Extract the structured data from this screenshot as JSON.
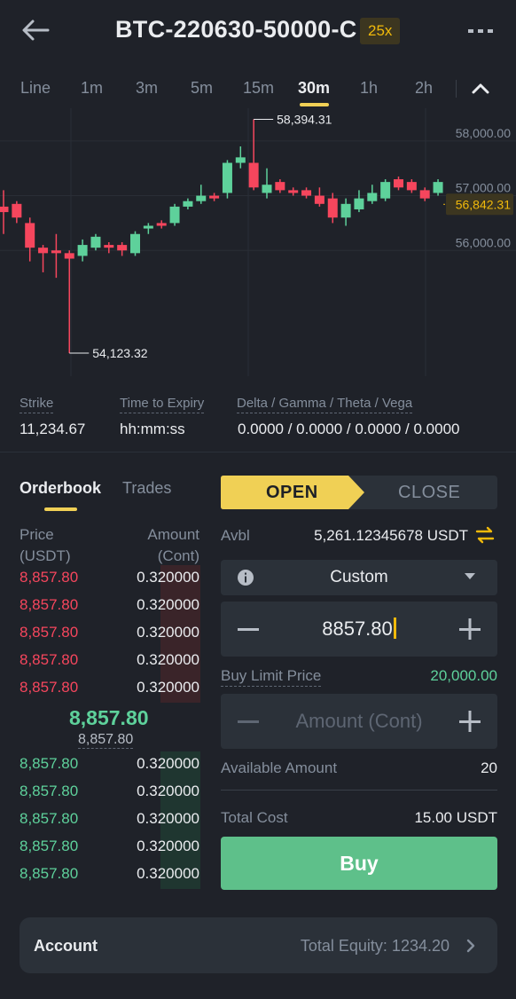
{
  "header": {
    "title": "BTC-220630-50000-C",
    "leverage": "25x",
    "icons": {
      "back": "back-arrow-icon",
      "more": "more-dots-icon"
    }
  },
  "intervals": {
    "items": [
      "Line",
      "1m",
      "3m",
      "5m",
      "15m",
      "30m",
      "1h",
      "2h"
    ],
    "active": "30m",
    "collapse_icon": "chevron-up-icon"
  },
  "chart": {
    "high_label": "58,394.31",
    "low_label": "54,123.32",
    "y_ticks": [
      "58,000.00",
      "57,000.00",
      "56,000.00"
    ],
    "last_price": "56,842.31",
    "colors": {
      "up": "#5ed19b",
      "down": "#f6465d",
      "last": "#f0b90b"
    }
  },
  "chart_data": {
    "type": "candlestick",
    "title": "",
    "ylim": [
      53800,
      58500
    ],
    "y_ticks": [
      58000,
      57000,
      56000
    ],
    "last_price": 56842.31,
    "high": 58394.31,
    "low": 54123.32,
    "candles": [
      {
        "o": 56800,
        "c": 56700,
        "h": 57100,
        "l": 56300
      },
      {
        "o": 56850,
        "c": 56600,
        "h": 56900,
        "l": 56500
      },
      {
        "o": 56500,
        "c": 56050,
        "h": 56600,
        "l": 55800
      },
      {
        "o": 56050,
        "c": 55950,
        "h": 56100,
        "l": 55600
      },
      {
        "o": 56000,
        "c": 55950,
        "h": 56300,
        "l": 55500
      },
      {
        "o": 55950,
        "c": 55850,
        "h": 56000,
        "l": 54123.32
      },
      {
        "o": 55900,
        "c": 56100,
        "h": 56200,
        "l": 55800
      },
      {
        "o": 56050,
        "c": 56250,
        "h": 56300,
        "l": 56000
      },
      {
        "o": 56100,
        "c": 56050,
        "h": 56150,
        "l": 55950
      },
      {
        "o": 56100,
        "c": 56000,
        "h": 56150,
        "l": 55900
      },
      {
        "o": 55950,
        "c": 56300,
        "h": 56350,
        "l": 55900
      },
      {
        "o": 56400,
        "c": 56450,
        "h": 56500,
        "l": 56300
      },
      {
        "o": 56500,
        "c": 56450,
        "h": 56550,
        "l": 56400
      },
      {
        "o": 56500,
        "c": 56800,
        "h": 56850,
        "l": 56450
      },
      {
        "o": 56800,
        "c": 56900,
        "h": 56950,
        "l": 56750
      },
      {
        "o": 56900,
        "c": 57000,
        "h": 57200,
        "l": 56850
      },
      {
        "o": 57000,
        "c": 56950,
        "h": 57050,
        "l": 56900
      },
      {
        "o": 57050,
        "c": 57600,
        "h": 57650,
        "l": 56950
      },
      {
        "o": 57600,
        "c": 57700,
        "h": 57900,
        "l": 57500
      },
      {
        "o": 57600,
        "c": 57150,
        "h": 58394.31,
        "l": 57100
      },
      {
        "o": 57050,
        "c": 57200,
        "h": 57500,
        "l": 56950
      },
      {
        "o": 57250,
        "c": 57100,
        "h": 57300,
        "l": 57050
      },
      {
        "o": 57100,
        "c": 57050,
        "h": 57150,
        "l": 57000
      },
      {
        "o": 57100,
        "c": 57000,
        "h": 57150,
        "l": 56950
      },
      {
        "o": 57000,
        "c": 56850,
        "h": 57150,
        "l": 56800
      },
      {
        "o": 56950,
        "c": 56600,
        "h": 57050,
        "l": 56500
      },
      {
        "o": 56600,
        "c": 56850,
        "h": 56950,
        "l": 56450
      },
      {
        "o": 56750,
        "c": 56950,
        "h": 57100,
        "l": 56700
      },
      {
        "o": 56900,
        "c": 57050,
        "h": 57200,
        "l": 56850
      },
      {
        "o": 56950,
        "c": 57250,
        "h": 57300,
        "l": 56900
      },
      {
        "o": 57300,
        "c": 57150,
        "h": 57350,
        "l": 57100
      },
      {
        "o": 57250,
        "c": 57100,
        "h": 57300,
        "l": 57050
      },
      {
        "o": 57100,
        "c": 56950,
        "h": 57150,
        "l": 56900
      },
      {
        "o": 57050,
        "c": 57250,
        "h": 57300,
        "l": 57000
      }
    ]
  },
  "greeks": {
    "strike_label": "Strike",
    "strike_value": "11,234.67",
    "expiry_label": "Time to Expiry",
    "expiry_value": "hh:mm:ss",
    "greeks_label": "Delta / Gamma / Theta / Vega",
    "greeks_value": "0.0000 / 0.0000 / 0.0000 / 0.0000"
  },
  "orderbook": {
    "tabs": [
      "Orderbook",
      "Trades"
    ],
    "price_header_1": "Price",
    "price_header_2": "(USDT)",
    "amount_header_1": "Amount",
    "amount_header_2": "(Cont)",
    "asks": [
      {
        "price": "8,857.80",
        "amount": "0.320000",
        "depth": 0.2
      },
      {
        "price": "8,857.80",
        "amount": "0.320000",
        "depth": 0.2
      },
      {
        "price": "8,857.80",
        "amount": "0.320000",
        "depth": 0.2
      },
      {
        "price": "8,857.80",
        "amount": "0.320000",
        "depth": 0.2
      },
      {
        "price": "8,857.80",
        "amount": "0.320000",
        "depth": 0.2
      }
    ],
    "mid_price": "8,857.80",
    "mark_price": "8,857.80",
    "bids": [
      {
        "price": "8,857.80",
        "amount": "0.320000",
        "depth": 0.2
      },
      {
        "price": "8,857.80",
        "amount": "0.320000",
        "depth": 0.2
      },
      {
        "price": "8,857.80",
        "amount": "0.320000",
        "depth": 0.2
      },
      {
        "price": "8,857.80",
        "amount": "0.320000",
        "depth": 0.2
      },
      {
        "price": "8,857.80",
        "amount": "0.320000",
        "depth": 0.2
      }
    ]
  },
  "trade": {
    "open_label": "OPEN",
    "close_label": "CLOSE",
    "avbl_label": "Avbl",
    "avbl_value": "5,261.12345678 USDT",
    "order_type": "Custom",
    "price_value": "8857.80",
    "limit_label": "Buy Limit Price",
    "limit_value": "20,000.00",
    "amount_placeholder": "Amount (Cont)",
    "available_amount_label": "Available Amount",
    "available_amount_value": "20",
    "total_cost_label": "Total Cost",
    "total_cost_value": "15.00 USDT",
    "buy_label": "Buy",
    "accent": "#f0d055",
    "buy_color": "#5ec08a"
  },
  "account": {
    "label": "Account",
    "equity": "Total Equity: 1234.20"
  }
}
